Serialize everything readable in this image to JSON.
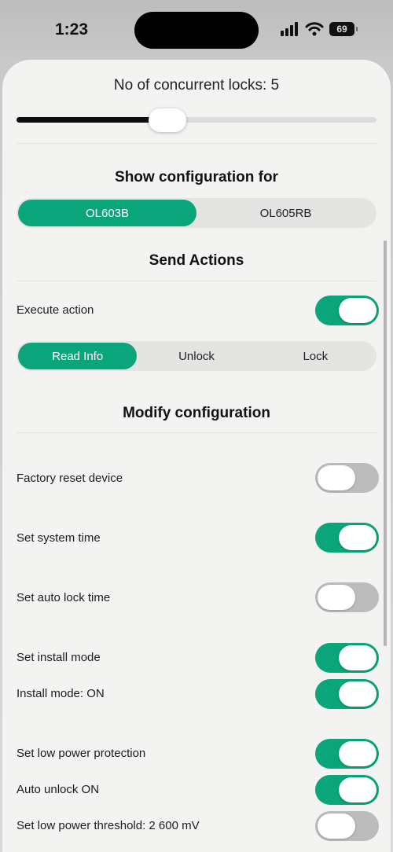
{
  "status_bar": {
    "time": "1:23",
    "battery": "69"
  },
  "concurrent": {
    "label": "No of concurrent locks: 5",
    "value": 5,
    "fraction": 0.42
  },
  "show_config": {
    "title": "Show configuration for",
    "options": [
      "OL603B",
      "OL605RB"
    ],
    "selected": "OL603B"
  },
  "send_actions": {
    "title": "Send Actions",
    "execute_label": "Execute action",
    "execute_on": true,
    "actions": [
      "Read Info",
      "Unlock",
      "Lock"
    ],
    "selected": "Read Info"
  },
  "modify": {
    "title": "Modify configuration",
    "rows": [
      {
        "label": "Factory reset device",
        "on": false
      },
      {
        "label": "Set system time",
        "on": true
      },
      {
        "label": "Set auto lock time",
        "on": false
      },
      {
        "label": "Set install mode",
        "on": true
      },
      {
        "label": "Install mode: ON",
        "on": true
      },
      {
        "label": "Set low power protection",
        "on": true
      },
      {
        "label": "Auto unlock ON",
        "on": true
      },
      {
        "label": "Set low power threshold: 2 600 mV",
        "on": false
      }
    ]
  },
  "colors": {
    "accent": "#0aa57a",
    "toggle_off": "#bcbcbc",
    "background": "#f3f3f1"
  }
}
